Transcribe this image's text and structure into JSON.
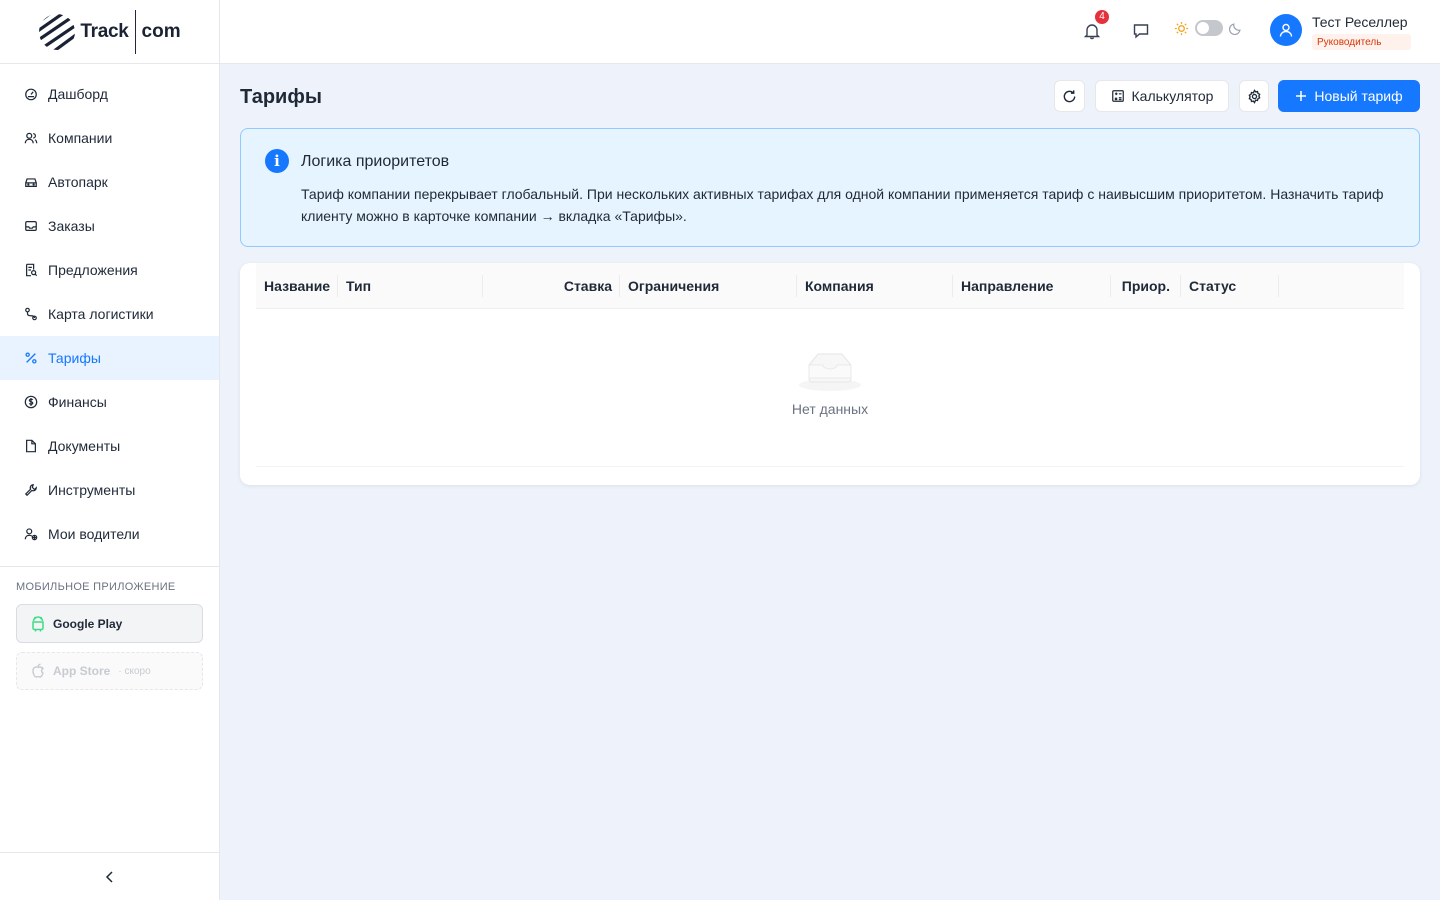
{
  "brand": {
    "logo_text": "Track",
    "logo_text2": "com"
  },
  "sidebar": {
    "items": [
      {
        "label": "Дашборд",
        "icon": "dashboard-icon"
      },
      {
        "label": "Компании",
        "icon": "users-icon"
      },
      {
        "label": "Автопарк",
        "icon": "car-icon"
      },
      {
        "label": "Заказы",
        "icon": "inbox-icon"
      },
      {
        "label": "Предложения",
        "icon": "document-search-icon"
      },
      {
        "label": "Карта логистики",
        "icon": "route-icon"
      },
      {
        "label": "Тарифы",
        "icon": "percent-icon",
        "active": true
      },
      {
        "label": "Финансы",
        "icon": "dollar-icon"
      },
      {
        "label": "Документы",
        "icon": "file-icon"
      },
      {
        "label": "Инструменты",
        "icon": "tool-icon"
      },
      {
        "label": "Мои водители",
        "icon": "driver-icon"
      }
    ],
    "mobile_title": "МОБИЛЬНОЕ ПРИЛОЖЕНИЕ",
    "google_play": "Google Play",
    "app_store": "App Store",
    "app_store_soon": "· скоро"
  },
  "header": {
    "notifications_count": "4",
    "user_name": "Тест Реселлер",
    "user_role": "Руководитель"
  },
  "page": {
    "title": "Тарифы",
    "calculator_label": "Калькулятор",
    "new_tariff_label": "Новый тариф"
  },
  "info": {
    "title": "Логика приоритетов",
    "text": "Тариф компании перекрывает глобальный. При нескольких активных тарифах для одной компании применяется тариф с наивысшим приоритетом. Назначить тариф клиенту можно в карточке компании → вкладка «Тарифы»."
  },
  "table": {
    "columns": [
      "Название",
      "Тип",
      "Ставка",
      "Ограничения",
      "Компания",
      "Направление",
      "Приор.",
      "Статус"
    ],
    "empty_text": "Нет данных"
  },
  "colors": {
    "accent": "#1677ff",
    "badge": "#e5313c",
    "info_bg": "#e6f4ff",
    "role": "#d4380d"
  }
}
